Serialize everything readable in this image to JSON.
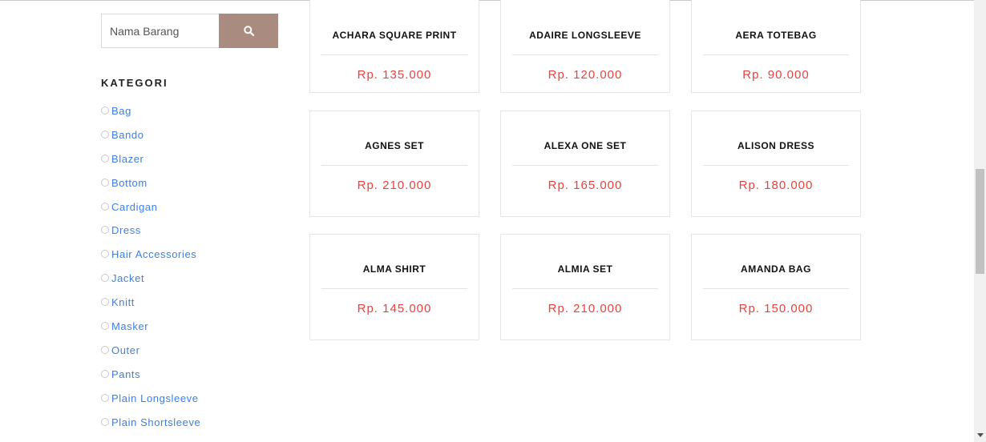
{
  "search": {
    "placeholder": "Nama Barang",
    "icon": "search-icon"
  },
  "sidebar": {
    "title": "KATEGORI",
    "categories": [
      "Bag",
      "Bando",
      "Blazer",
      "Bottom",
      "Cardigan",
      "Dress",
      "Hair Accessories",
      "Jacket",
      "Knitt",
      "Masker",
      "Outer",
      "Pants",
      "Plain Longsleeve",
      "Plain Shortsleeve"
    ]
  },
  "products": [
    {
      "name": "ACHARA SQUARE PRINT",
      "price": "Rp. 135.000"
    },
    {
      "name": "ADAIRE LONGSLEEVE",
      "price": "Rp. 120.000"
    },
    {
      "name": "AERA TOTEBAG",
      "price": "Rp. 90.000"
    },
    {
      "name": "AGNES SET",
      "price": "Rp. 210.000"
    },
    {
      "name": "ALEXA ONE SET",
      "price": "Rp. 165.000"
    },
    {
      "name": "ALISON DRESS",
      "price": "Rp. 180.000"
    },
    {
      "name": "ALMA SHIRT",
      "price": "Rp. 145.000"
    },
    {
      "name": "ALMIA SET",
      "price": "Rp. 210.000"
    },
    {
      "name": "AMANDA BAG",
      "price": "Rp. 150.000"
    }
  ],
  "colors": {
    "accent": "#a98c7f",
    "price": "#e8423f",
    "link": "#3d7fe6"
  }
}
